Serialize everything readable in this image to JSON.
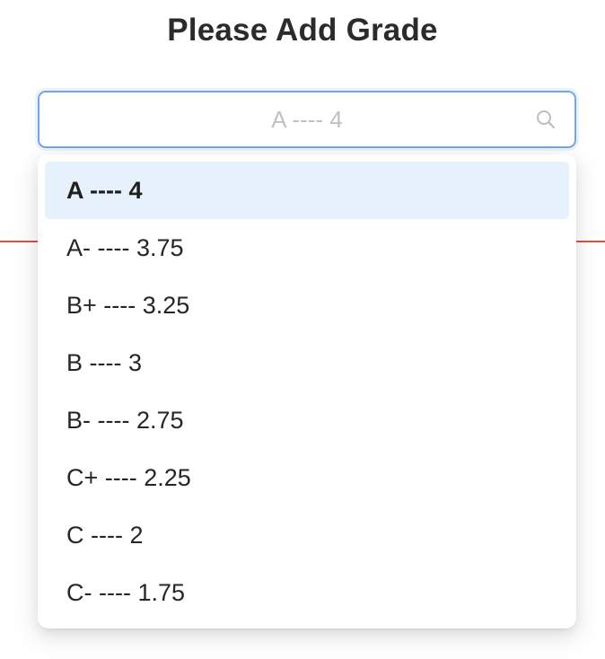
{
  "page": {
    "title": "Please Add Grade"
  },
  "grade_select": {
    "placeholder": "A ---- 4",
    "value": "",
    "options": [
      {
        "label": "A ---- 4",
        "selected": true
      },
      {
        "label": "A- ---- 3.75",
        "selected": false
      },
      {
        "label": "B+ ---- 3.25",
        "selected": false
      },
      {
        "label": "B ---- 3",
        "selected": false
      },
      {
        "label": "B- ---- 2.75",
        "selected": false
      },
      {
        "label": "C+ ---- 2.25",
        "selected": false
      },
      {
        "label": "C ---- 2",
        "selected": false
      },
      {
        "label": "C- ---- 1.75",
        "selected": false
      }
    ]
  },
  "colors": {
    "accent": "#6fa7ea",
    "selected_bg": "#e6f1fc",
    "divider": "#e0503f"
  },
  "icons": {
    "search": "search-icon"
  }
}
